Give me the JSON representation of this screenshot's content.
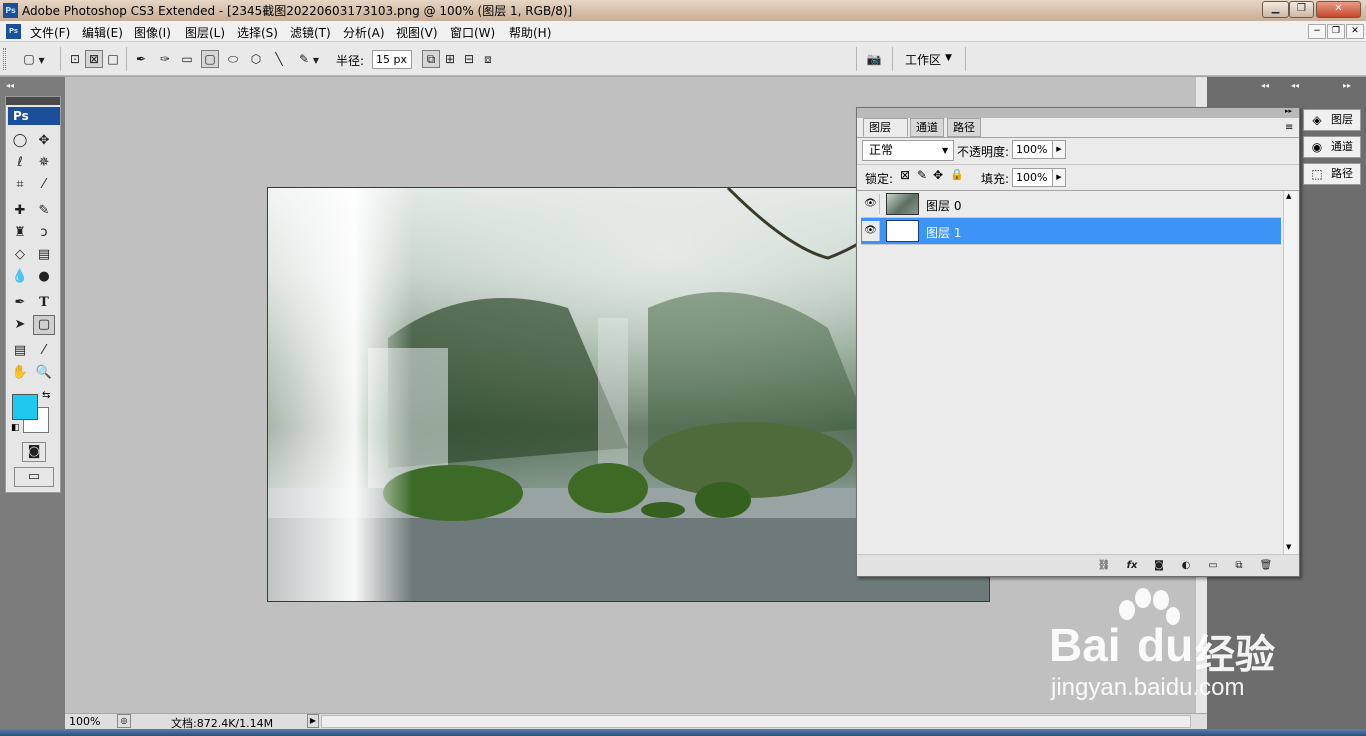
{
  "window": {
    "title": "Adobe Photoshop CS3 Extended - [2345截图20220603173103.png @ 100% (图层 1, RGB/8)]",
    "logo_text": "Ps",
    "minimize": "▁",
    "restore": "❐",
    "close": "✕"
  },
  "menubar": {
    "logo_text": "Ps",
    "items": [
      "文件(F)",
      "编辑(E)",
      "图像(I)",
      "图层(L)",
      "选择(S)",
      "滤镜(T)",
      "分析(A)",
      "视图(V)",
      "窗口(W)",
      "帮助(H)"
    ],
    "doc_minimize": "−",
    "doc_restore": "❐",
    "doc_close": "✕"
  },
  "options": {
    "radius_label": "半径:",
    "radius_value": "15 px",
    "workspace_label": "工作区"
  },
  "toolbox": {
    "logo_text": "Ps",
    "colors": {
      "foreground": "#1ec8ee",
      "background": "#ffffff"
    }
  },
  "statusbar": {
    "zoom": "100%",
    "doc_info": "文档:872.4K/1.14M"
  },
  "dock": {
    "layers": "图层",
    "channels": "通道",
    "paths": "路径"
  },
  "layers_panel": {
    "tabs": [
      "图层",
      "通道",
      "路径"
    ],
    "blend_mode": "正常",
    "opacity_label": "不透明度:",
    "opacity_value": "100%",
    "lock_label": "锁定:",
    "fill_label": "填充:",
    "fill_value": "100%",
    "layers": [
      {
        "name": "图层 0",
        "selected": false
      },
      {
        "name": "图层 1",
        "selected": true
      }
    ]
  },
  "watermark": {
    "brand": "Bai",
    "brand2": "du",
    "cn": "经验",
    "url": "jingyan.baidu.com"
  }
}
